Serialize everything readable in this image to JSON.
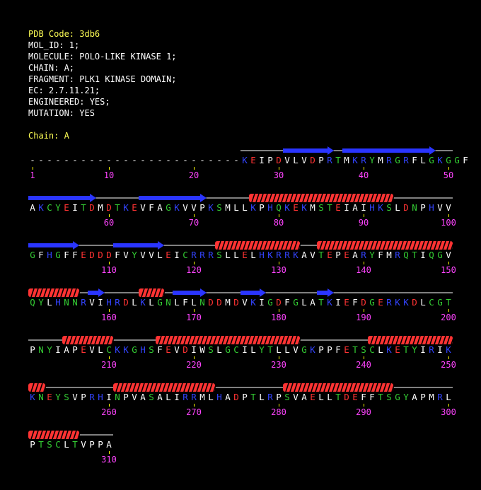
{
  "header": {
    "pdb_line": "PDB Code: 3db6",
    "lines": [
      "MOL_ID: 1;",
      "MOLECULE: POLO-LIKE KINASE 1;",
      "CHAIN: A;",
      "FRAGMENT: PLK1 KINASE DOMAIN;",
      "EC: 2.7.11.21;",
      "ENGINEERED: YES;",
      "MUTATION: YES"
    ],
    "chain_line": "Chain: A"
  },
  "colors": {
    "hydrophobic": "#ffffff",
    "polar": "#33cc33",
    "acidic": "#ff3333",
    "basic": "#3344ff",
    "gap": "#ffffff",
    "number": "#ff44ff",
    "strand": "#2a35ff",
    "helix": "#ff3333"
  },
  "rows": [
    {
      "start": 1,
      "seq": "-------------------------KEIPDVLVDPRTMKRYMRGRFLGKGGF",
      "numbers": [
        1,
        10,
        20,
        30,
        40,
        50
      ]
    },
    {
      "start": 51,
      "seq": "AKCYEITDMDTKEVFAGKVVPKSMLLKPHQKEKMSTEIAIHKSLDNPHVV",
      "numbers": [
        60,
        70,
        80,
        90,
        100
      ]
    },
    {
      "start": 101,
      "seq": "GFHGFFEDDDFVYVVLEICRRRSLLELHKRRKAVTEPEARYFMRQTIQGV",
      "numbers": [
        110,
        120,
        130,
        140,
        150
      ]
    },
    {
      "start": 151,
      "seq": "QYLHNNRVIHRDLKLGNLFLNDDMDVKIGDFGLATKIEFDGERKKDLCGT",
      "numbers": [
        160,
        170,
        180,
        190,
        200
      ]
    },
    {
      "start": 201,
      "seq": "PNYIAPEVLCKKGHSFEVDIWSLGCILYTLLVGKPPFETSCLKETYIRIK",
      "numbers": [
        210,
        220,
        230,
        240,
        250
      ]
    },
    {
      "start": 251,
      "seq": "KNEYSVPRHINPVASALIRRMLHADPTLRPSVAELLTDEFFTSGYAPMRL",
      "numbers": [
        260,
        270,
        280,
        290,
        300
      ]
    },
    {
      "start": 301,
      "seq": "PTSCLTVPPA",
      "numbers": [
        310
      ]
    }
  ],
  "secondary_structure": [
    {
      "row": 0,
      "coil": [
        [
          26,
          50
        ]
      ],
      "strands": [
        [
          31,
          36
        ],
        [
          38,
          48
        ]
      ],
      "helices": []
    },
    {
      "row": 1,
      "coil": [
        [
          51,
          100
        ]
      ],
      "strands": [
        [
          51,
          58
        ],
        [
          64,
          71
        ]
      ],
      "helices": [
        [
          77,
          93
        ]
      ]
    },
    {
      "row": 2,
      "coil": [
        [
          101,
          150
        ]
      ],
      "strands": [
        [
          101,
          106
        ],
        [
          111,
          116
        ],
        [
          111,
          116
        ]
      ],
      "helices": [
        [
          123,
          132
        ],
        [
          135,
          150
        ]
      ]
    },
    {
      "row": 3,
      "coil": [
        [
          151,
          200
        ]
      ],
      "strands": [
        [
          158,
          159
        ],
        [
          168,
          171
        ],
        [
          176,
          178
        ],
        [
          185,
          186
        ]
      ],
      "helices": [
        [
          151,
          156
        ],
        [
          164,
          166
        ]
      ]
    },
    {
      "row": 4,
      "coil": [
        [
          201,
          250
        ]
      ],
      "strands": [],
      "helices": [
        [
          205,
          210
        ],
        [
          216,
          232
        ],
        [
          241,
          250
        ]
      ]
    },
    {
      "row": 5,
      "coil": [
        [
          251,
          300
        ]
      ],
      "strands": [],
      "helices": [
        [
          251,
          252
        ],
        [
          261,
          272
        ],
        [
          281,
          293
        ]
      ]
    },
    {
      "row": 6,
      "coil": [
        [
          301,
          310
        ]
      ],
      "strands": [],
      "helices": [
        [
          301,
          306
        ]
      ]
    }
  ]
}
